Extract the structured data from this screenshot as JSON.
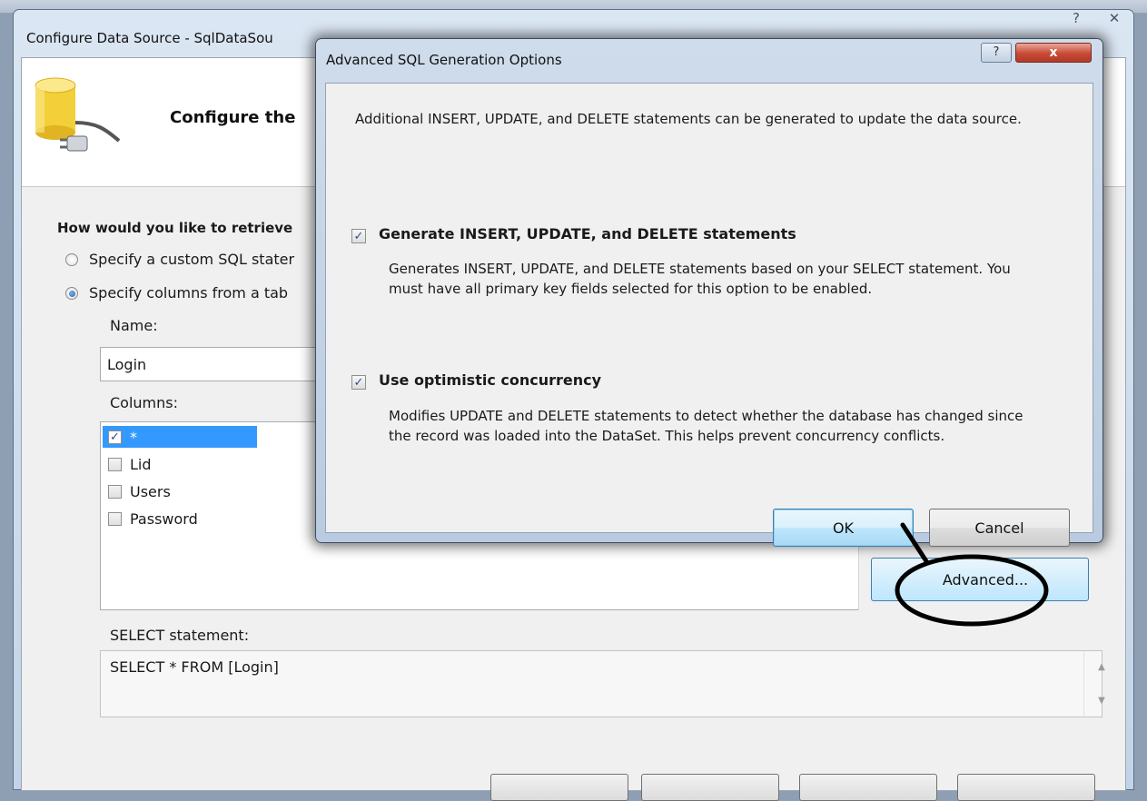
{
  "main": {
    "title": "Configure Data Source - SqlDataSou",
    "header_title": "Configure the",
    "question": "How would you like to retrieve",
    "radio_custom": "Specify a custom SQL stater",
    "radio_columns": "Specify columns from a tab",
    "name_label": "Name:",
    "name_value": "Login",
    "columns_label": "Columns:",
    "columns": [
      {
        "label": "*",
        "checked": true,
        "selected": true
      },
      {
        "label": "Lid",
        "checked": false
      },
      {
        "label": "Users",
        "checked": false
      },
      {
        "label": "Password",
        "checked": false
      }
    ],
    "advanced_button": "Advanced...",
    "select_label": "SELECT statement:",
    "select_text": "SELECT * FROM [Login]"
  },
  "dialog": {
    "title": "Advanced SQL Generation Options",
    "help_glyph": "?",
    "close_glyph": "x",
    "description": "Additional INSERT, UPDATE, and DELETE statements can be generated to update the data source.",
    "option1": {
      "label": "Generate INSERT, UPDATE, and DELETE statements",
      "checked": true,
      "description": "Generates INSERT, UPDATE, and DELETE statements based on your SELECT statement. You must have all primary key fields selected for this option to be enabled."
    },
    "option2": {
      "label": "Use optimistic concurrency",
      "checked": true,
      "description": "Modifies UPDATE and DELETE statements to detect whether the database has changed since the record was loaded into the DataSet. This helps prevent concurrency conflicts."
    },
    "ok_button": "OK",
    "cancel_button": "Cancel"
  },
  "icons": {
    "check_glyph": "✓",
    "scroll_up": "▲",
    "scroll_down": "▼"
  },
  "colors": {
    "selection": "#3399ff",
    "default_button_border": "#3c7fb1",
    "close_button": "#c74a35"
  }
}
